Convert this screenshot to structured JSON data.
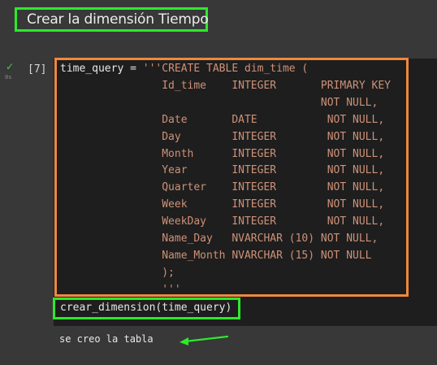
{
  "heading": {
    "text": "Crear la dimensión Tiempo"
  },
  "cell": {
    "execution_count": "[7]",
    "status_icon": "check-icon",
    "time_label": "0s",
    "code": {
      "var_name": "time_query",
      "assign": " = ",
      "sql_lines": [
        "'''CREATE TABLE dim_time (",
        "                Id_time    INTEGER       PRIMARY KEY",
        "                                         NOT NULL,",
        "                Date       DATE           NOT NULL,",
        "                Day        INTEGER        NOT NULL,",
        "                Month      INTEGER        NOT NULL,",
        "                Year       INTEGER        NOT NULL,",
        "                Quarter    INTEGER        NOT NULL,",
        "                Week       INTEGER        NOT NULL,",
        "                WeekDay    INTEGER        NOT NULL,",
        "                Name_Day   NVARCHAR (10) NOT NULL,",
        "                Name_Month NVARCHAR (15) NOT NULL",
        "                );",
        "                '''"
      ],
      "call_line": "crear_dimension(time_query)"
    },
    "output": "se creo la tabla"
  },
  "colors": {
    "highlight_green": "#2ee82e",
    "highlight_orange": "#f0883e",
    "string": "#ce9178"
  }
}
